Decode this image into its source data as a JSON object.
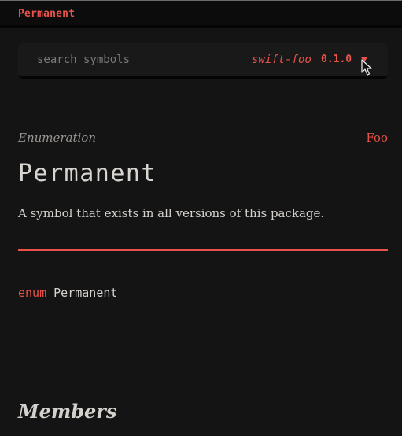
{
  "topbar": {
    "title": "Permanent"
  },
  "search": {
    "placeholder": "search symbols",
    "package_name": "swift-foo",
    "package_version": "0.1.0"
  },
  "symbol": {
    "kind": "Enumeration",
    "module": "Foo",
    "name": "Permanent",
    "summary": "A symbol that exists in all versions of this package."
  },
  "declaration": {
    "keyword": "enum",
    "name": "Permanent"
  },
  "sections": {
    "members_heading": "Members"
  },
  "colors": {
    "accent": "#e8524a",
    "background": "#141414",
    "text": "#d4d0cc"
  },
  "icons": {
    "dropdown": "chevron-down-icon",
    "cursor": "mouse-cursor-icon"
  }
}
